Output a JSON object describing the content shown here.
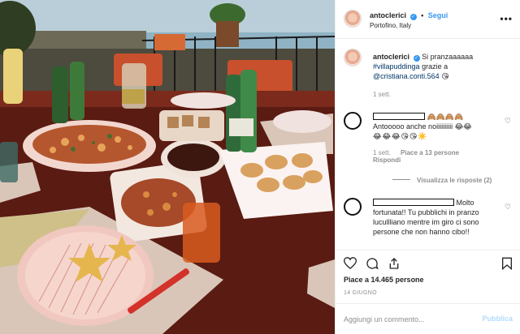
{
  "post": {
    "username": "antoclerici",
    "verified_glyph": "✓",
    "separator": "•",
    "follow_label": "Segui",
    "location": "Portofino, Italy",
    "more_icon": "more-options-icon"
  },
  "caption": {
    "username": "antoclerici",
    "text_1": "Si pranzaaaaaa",
    "hashtag": "#villapuddinga",
    "text_2": "grazie a",
    "mention": "@cristiana.conti.564",
    "emoji": "😘",
    "time": "1 sett."
  },
  "comments": [
    {
      "emoji_after_name": "🙈🙈🙈🙈",
      "text": "Antooooo anche noiiiiiiiiii 😂😂",
      "emoji_line": "😂😂😂😘😘☀️",
      "time": "1 sett.",
      "likes": "Piace a 13 persone",
      "reply": "Rispondi",
      "view_replies": "Visualizza le risposte (2)"
    },
    {
      "text_after_name": "Molto",
      "text": "fortunata!! Tu pubblichi in pranzo lucullliano mentre im giro ci sono persone che non hanno cibo!!"
    }
  ],
  "actions": {
    "like_icon": "heart-icon",
    "comment_icon": "comment-icon",
    "share_icon": "share-icon",
    "save_icon": "bookmark-icon"
  },
  "likes_text": "Piace a 14.465 persone",
  "date": "14 GIUGNO",
  "add_comment": {
    "placeholder": "Aggiungi un commento...",
    "publish_label": "Pubblica"
  },
  "colors": {
    "link": "#003569",
    "accent": "#3897f0",
    "publish_disabled": "#b3dbff",
    "muted": "#8e8e8e"
  }
}
